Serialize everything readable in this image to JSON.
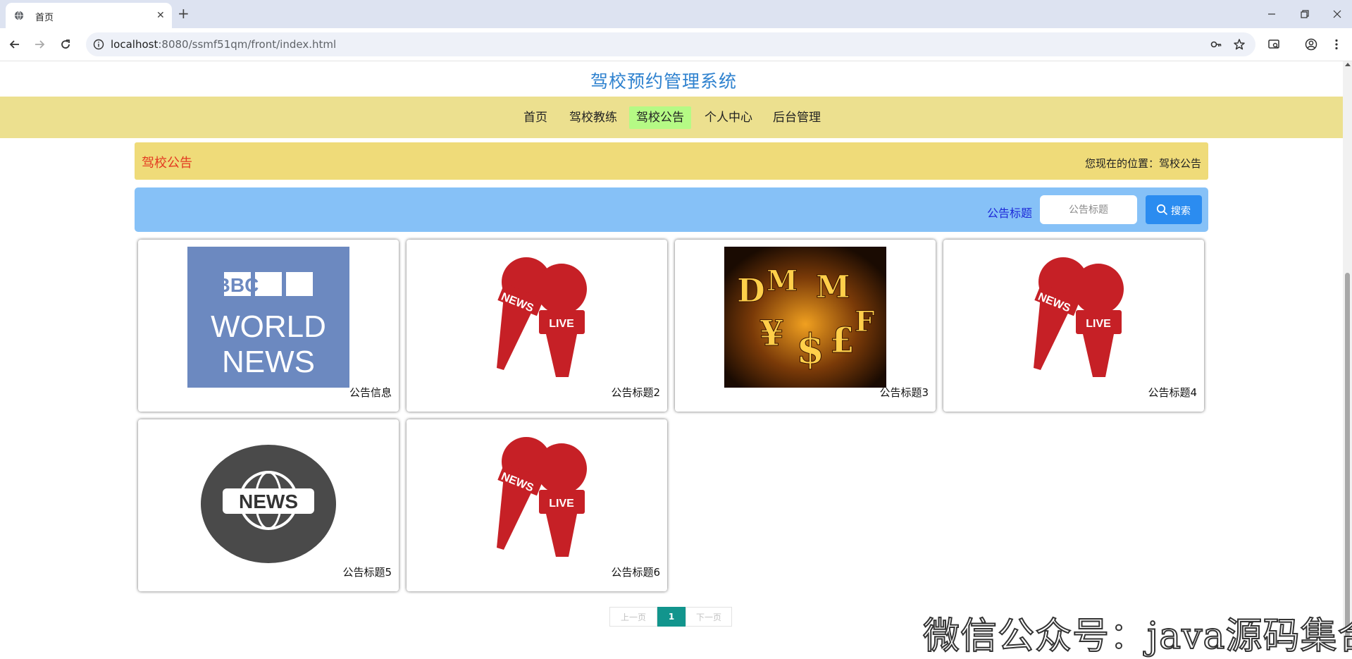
{
  "browser": {
    "tab_title": "首页",
    "url_host": "localhost",
    "url_rest": ":8080/ssmf51qm/front/index.html"
  },
  "site": {
    "title": "驾校预约管理系统"
  },
  "nav": {
    "items": [
      {
        "label": "首页"
      },
      {
        "label": "驾校教练"
      },
      {
        "label": "驾校公告"
      },
      {
        "label": "个人中心"
      },
      {
        "label": "后台管理"
      }
    ],
    "active_index": 2,
    "active_color": "#b5fa85"
  },
  "breadcrumb": {
    "title": "驾校公告",
    "position_text": "您现在的位置：驾校公告"
  },
  "search": {
    "label": "公告标题",
    "placeholder": "公告标题",
    "button_label": "搜索"
  },
  "cards": [
    {
      "title": "公告信息",
      "image": "bbc-world-news-logo"
    },
    {
      "title": "公告标题2",
      "image": "news-live-microphones"
    },
    {
      "title": "公告标题3",
      "image": "currency-symbols-photo"
    },
    {
      "title": "公告标题4",
      "image": "news-live-microphones"
    },
    {
      "title": "公告标题5",
      "image": "news-globe-badge"
    },
    {
      "title": "公告标题6",
      "image": "news-live-microphones"
    }
  ],
  "bbc_image_text": {
    "brand": "BBC",
    "line1": "WORLD",
    "line2": "NEWS"
  },
  "mic_image_text": {
    "left": "NEWS",
    "right": "LIVE"
  },
  "globe_image_text": "NEWS",
  "pagination": {
    "prev": "上一页",
    "current": "1",
    "next": "下一页"
  },
  "watermark": "微信公众号：java源码集合",
  "colors": {
    "title_blue": "#2f82cf",
    "nav_bg": "#ece08f",
    "breadcrumb_bg": "#efdb79",
    "breadcrumb_title": "#e33a21",
    "search_bar_bg": "#86c1f7",
    "search_button": "#2b8cf0",
    "pager_current": "#12958d"
  }
}
